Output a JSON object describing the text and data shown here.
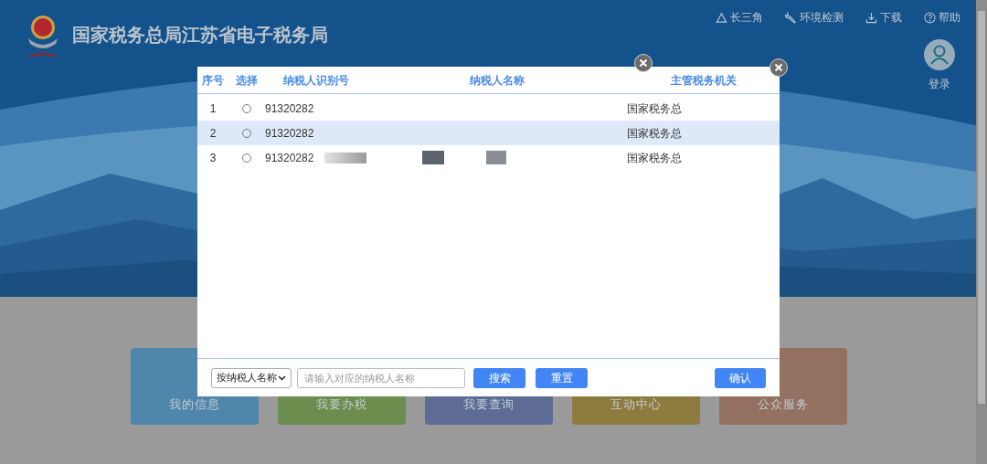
{
  "header": {
    "title": "国家税务总局江苏省电子税务局",
    "links": [
      {
        "kind": "triangle",
        "label": "长三角"
      },
      {
        "kind": "wrench",
        "label": "环境检测"
      },
      {
        "kind": "download",
        "label": "下载"
      },
      {
        "kind": "help",
        "label": "帮助"
      }
    ],
    "login": "登录"
  },
  "cards": [
    {
      "label": "我的信息",
      "color": "#4f86ab"
    },
    {
      "label": "我要办税",
      "color": "#6b8e4e"
    },
    {
      "label": "我要查询",
      "color": "#5d6b95"
    },
    {
      "label": "互动中心",
      "color": "#8e7c3f"
    },
    {
      "label": "公众服务",
      "color": "#93705f"
    }
  ],
  "dialog": {
    "columns": [
      "序号",
      "选择",
      "纳税人识别号",
      "纳税人名称",
      "主管税务机关"
    ],
    "rows": [
      {
        "index": "1",
        "checked": false,
        "selected": false,
        "taxpayer_id": "91320282",
        "authority": "国家税务总"
      },
      {
        "index": "2",
        "checked": false,
        "selected": true,
        "taxpayer_id": "91320282",
        "authority": "国家税务总"
      },
      {
        "index": "3",
        "checked": false,
        "selected": false,
        "taxpayer_id": "91320282",
        "authority": "国家税务总"
      }
    ],
    "search_type": "按纳税人名称",
    "search": {
      "placeholder": "请输入对应的纳税人名称"
    },
    "buttons": [
      "搜索",
      "重置"
    ],
    "confirm": "确认"
  }
}
